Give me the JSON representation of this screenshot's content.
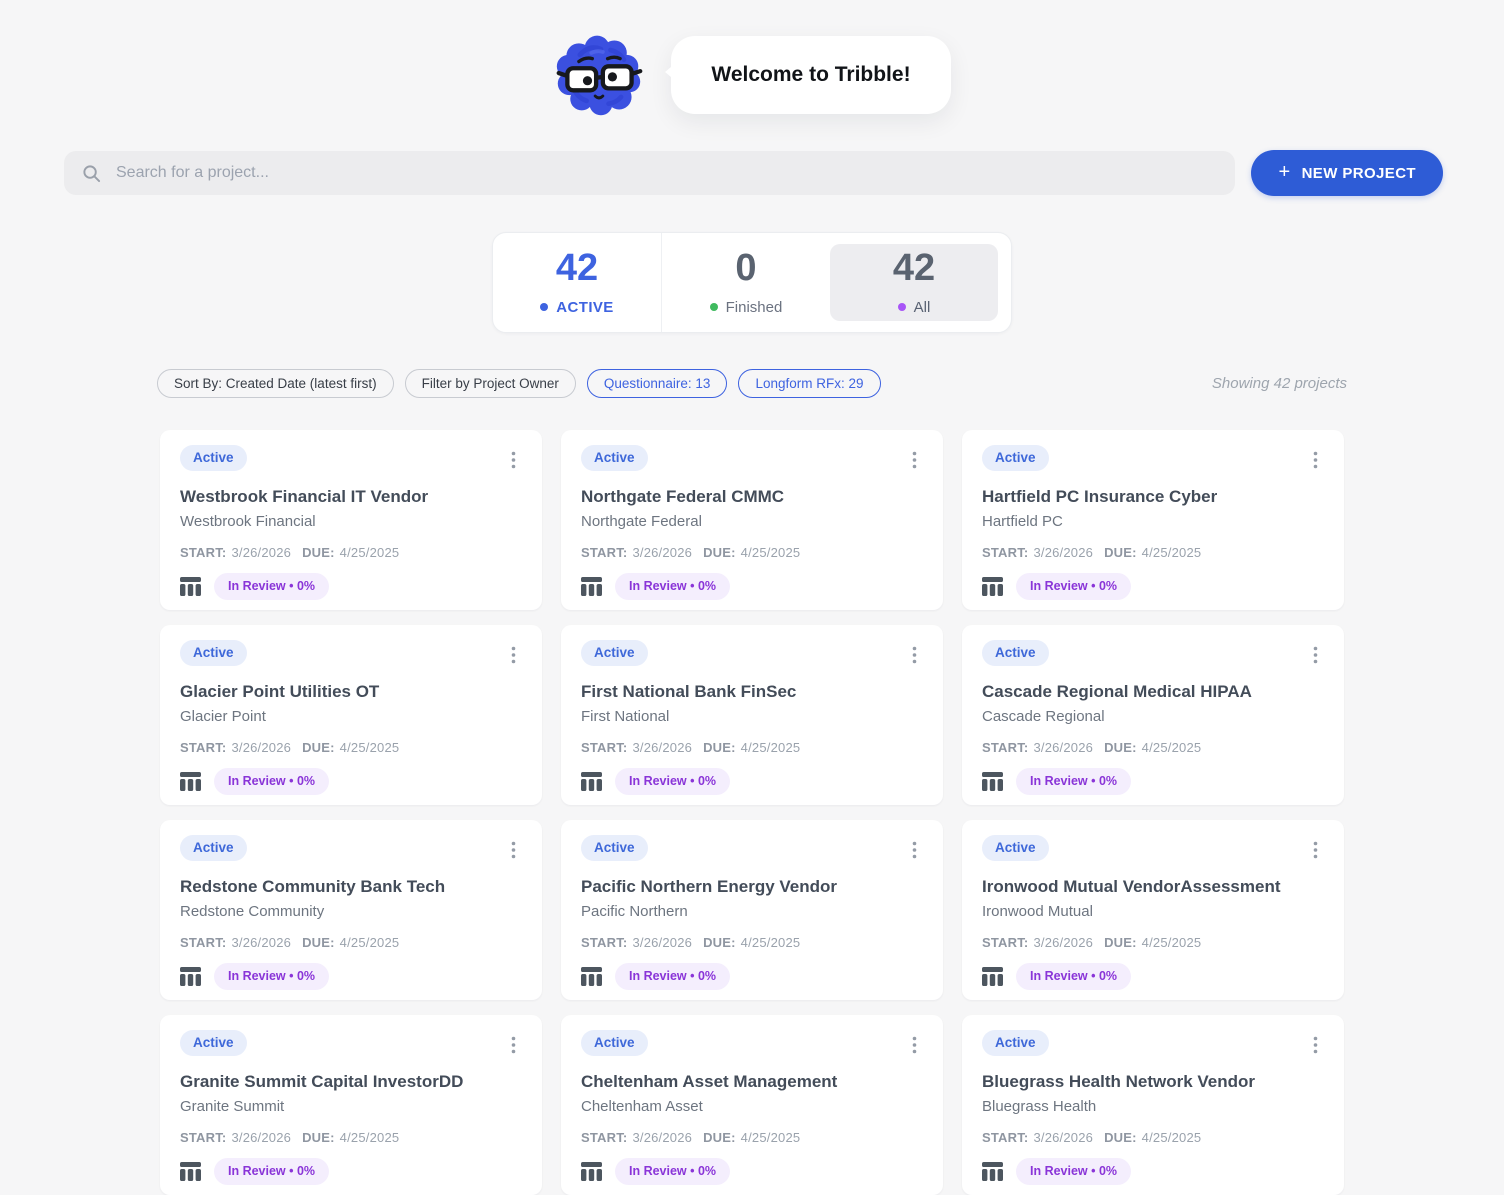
{
  "welcome": {
    "text": "Welcome to Tribble!"
  },
  "search": {
    "placeholder": "Search for a project..."
  },
  "new_project": {
    "plus": "+",
    "label": "NEW PROJECT"
  },
  "stats": {
    "items": [
      {
        "value": "42",
        "label": "ACTIVE",
        "dot_color": "#3e63e0"
      },
      {
        "value": "0",
        "label": "Finished",
        "dot_color": "#3fba5f"
      },
      {
        "value": "42",
        "label": "All",
        "dot_color": "#a855f7"
      }
    ]
  },
  "filters": {
    "sort_by": "Sort By: Created Date (latest first)",
    "owner": "Filter by Project Owner",
    "questionnaire": "Questionnaire: 13",
    "longform": "Longform RFx: 29",
    "showing": "Showing 42 projects"
  },
  "card_labels": {
    "start": "START:",
    "due": "DUE:"
  },
  "projects": [
    {
      "status": "Active",
      "title": "Westbrook Financial IT Vendor",
      "subtitle": "Westbrook Financial",
      "start": "3/26/2026",
      "due": "4/25/2025",
      "review": "In Review • 0%"
    },
    {
      "status": "Active",
      "title": "Northgate Federal CMMC",
      "subtitle": "Northgate Federal",
      "start": "3/26/2026",
      "due": "4/25/2025",
      "review": "In Review • 0%"
    },
    {
      "status": "Active",
      "title": "Hartfield PC Insurance Cyber",
      "subtitle": "Hartfield PC",
      "start": "3/26/2026",
      "due": "4/25/2025",
      "review": "In Review • 0%"
    },
    {
      "status": "Active",
      "title": "Glacier Point Utilities OT",
      "subtitle": "Glacier Point",
      "start": "3/26/2026",
      "due": "4/25/2025",
      "review": "In Review • 0%"
    },
    {
      "status": "Active",
      "title": "First National Bank FinSec",
      "subtitle": "First National",
      "start": "3/26/2026",
      "due": "4/25/2025",
      "review": "In Review • 0%"
    },
    {
      "status": "Active",
      "title": "Cascade Regional Medical HIPAA",
      "subtitle": "Cascade Regional",
      "start": "3/26/2026",
      "due": "4/25/2025",
      "review": "In Review • 0%"
    },
    {
      "status": "Active",
      "title": "Redstone Community Bank Tech",
      "subtitle": "Redstone Community",
      "start": "3/26/2026",
      "due": "4/25/2025",
      "review": "In Review • 0%"
    },
    {
      "status": "Active",
      "title": "Pacific Northern Energy Vendor",
      "subtitle": "Pacific Northern",
      "start": "3/26/2026",
      "due": "4/25/2025",
      "review": "In Review • 0%"
    },
    {
      "status": "Active",
      "title": "Ironwood Mutual VendorAssessment",
      "subtitle": "Ironwood Mutual",
      "start": "3/26/2026",
      "due": "4/25/2025",
      "review": "In Review • 0%"
    },
    {
      "status": "Active",
      "title": "Granite Summit Capital InvestorDD",
      "subtitle": "Granite Summit",
      "start": "3/26/2026",
      "due": "4/25/2025",
      "review": "In Review • 0%"
    },
    {
      "status": "Active",
      "title": "Cheltenham Asset Management",
      "subtitle": "Cheltenham Asset",
      "start": "3/26/2026",
      "due": "4/25/2025",
      "review": "In Review • 0%"
    },
    {
      "status": "Active",
      "title": "Bluegrass Health Network Vendor",
      "subtitle": "Bluegrass Health",
      "start": "3/26/2026",
      "due": "4/25/2025",
      "review": "In Review • 0%"
    }
  ],
  "colors": {
    "page_background": "#f6f6f7",
    "accent_blue": "#2e5cd6",
    "active_blue": "#3e63e0",
    "finished_green": "#3fba5f",
    "all_purple": "#a855f7",
    "status_badge_bg": "#e8eefb",
    "status_badge_text": "#3e68d9",
    "review_pill_bg": "#f4eefd",
    "review_pill_text": "#8a35d8",
    "mascot_blue": "#3b50e0"
  }
}
